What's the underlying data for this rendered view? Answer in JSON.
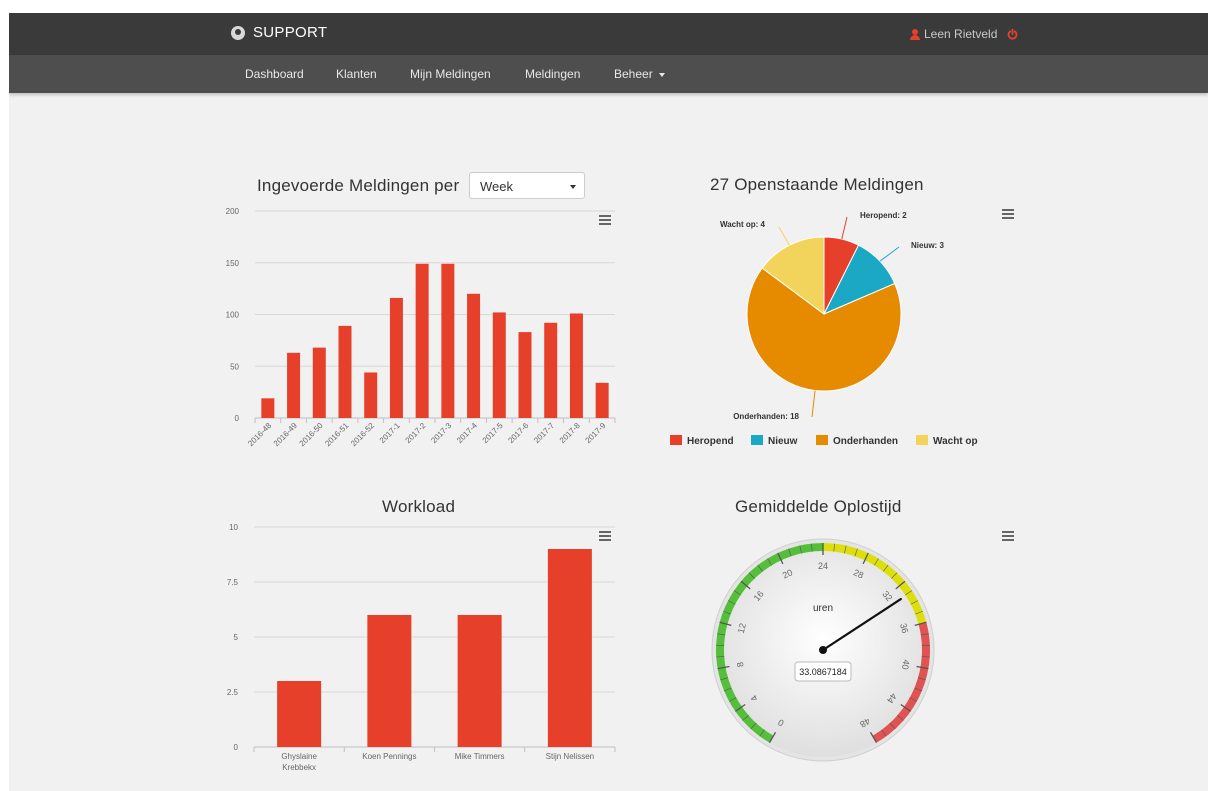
{
  "app": {
    "brand": "SUPPORT",
    "user_name": "Leen Rietveld",
    "icons": {
      "brand": "logo-icon",
      "user": "user-icon",
      "logout": "power-icon"
    },
    "accent_color": "#e7402a"
  },
  "nav": {
    "items": [
      {
        "label": "Dashboard"
      },
      {
        "label": "Klanten"
      },
      {
        "label": "Mijn Meldingen"
      },
      {
        "label": "Meldingen"
      },
      {
        "label": "Beheer"
      }
    ]
  },
  "panels": {
    "per_week": {
      "title": "Ingevoerde Meldingen per",
      "select_value": "Week"
    },
    "open": {
      "title": "27 Openstaande Meldingen"
    },
    "workload": {
      "title": "Workload"
    },
    "avg": {
      "title": "Gemiddelde Oplostijd"
    }
  },
  "chart_data": [
    {
      "type": "bar",
      "title": "Ingevoerde Meldingen per",
      "categories": [
        "2016-48",
        "2016-49",
        "2016-50",
        "2016-51",
        "2016-52",
        "2017-1",
        "2017-2",
        "2017-3",
        "2017-4",
        "2017-5",
        "2017-6",
        "2017-7",
        "2017-8",
        "2017-9"
      ],
      "values": [
        19,
        63,
        68,
        89,
        44,
        116,
        149,
        149,
        120,
        102,
        83,
        92,
        101,
        34
      ],
      "ylim": [
        0,
        200
      ],
      "yticks": [
        "0",
        "50",
        "100",
        "150",
        "200"
      ],
      "grid": true,
      "color": "#e7402a"
    },
    {
      "type": "pie",
      "title": "27 Openstaande Meldingen",
      "slices": [
        {
          "name": "Heropend",
          "value": 2,
          "color": "#e7402a",
          "label": "Heropend: 2"
        },
        {
          "name": "Nieuw",
          "value": 3,
          "color": "#1ba8c5",
          "label": "Nieuw: 3"
        },
        {
          "name": "Onderhanden",
          "value": 18,
          "color": "#e68a00",
          "label": "Onderhanden: 18"
        },
        {
          "name": "Wacht op",
          "value": 4,
          "color": "#f2d45c",
          "label": "Wacht op: 4"
        }
      ],
      "legend": "bottom"
    },
    {
      "type": "bar",
      "title": "Workload",
      "categories": [
        "Ghyslaine Krebbekx",
        "Koen Pennings",
        "Mike Timmers",
        "Stijn Nelissen"
      ],
      "category_lines": [
        [
          "Ghyslaine",
          "Krebbekx"
        ],
        [
          "Koen Pennings"
        ],
        [
          "Mike Timmers"
        ],
        [
          "Stijn Nelissen"
        ]
      ],
      "values": [
        3,
        6,
        6,
        9
      ],
      "ylim": [
        0,
        10
      ],
      "yticks": [
        "0",
        "2.5",
        "5",
        "7.5",
        "10"
      ],
      "grid": true,
      "color": "#e7402a"
    },
    {
      "type": "gauge",
      "title": "Gemiddelde Oplostijd",
      "unit_label": "uren",
      "value": 33.0867184,
      "value_label": "33.0867184",
      "min": 0,
      "max": 48,
      "tick_labels": [
        "0",
        "4",
        "8",
        "12",
        "16",
        "20",
        "24",
        "28",
        "32",
        "36",
        "40",
        "44",
        "48"
      ],
      "bands": [
        {
          "from": 0,
          "to": 24,
          "color": "#55bf3b"
        },
        {
          "from": 24,
          "to": 36,
          "color": "#dddf0d"
        },
        {
          "from": 36,
          "to": 48,
          "color": "#df5353"
        }
      ]
    }
  ]
}
